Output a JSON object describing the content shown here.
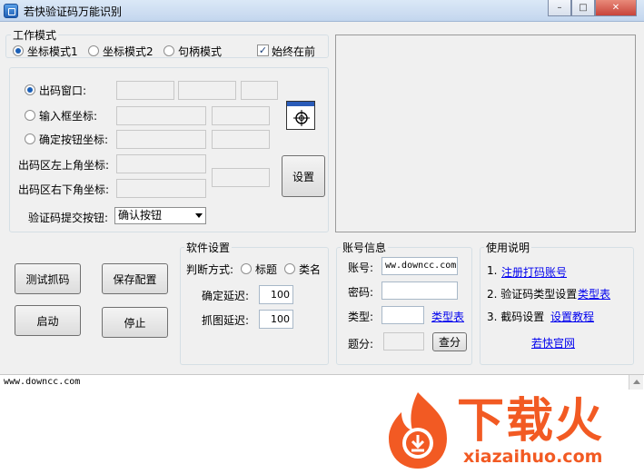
{
  "window": {
    "title": "若快验证码万能识别",
    "minimize": "–",
    "maximize": "□",
    "close": "✕"
  },
  "work_mode": {
    "title": "工作模式",
    "modes": [
      {
        "label": "坐标模式1",
        "checked": true
      },
      {
        "label": "坐标模式2",
        "checked": false
      },
      {
        "label": "句柄模式",
        "checked": false
      }
    ],
    "always_on_top": {
      "label": "始终在前",
      "checked": true
    }
  },
  "coords": {
    "code_window": "出码窗口:",
    "input_box": "输入框坐标:",
    "confirm_button": "确定按钮坐标:",
    "top_left": "出码区左上角坐标:",
    "bottom_right": "出码区右下角坐标:",
    "submit_label": "验证码提交按钮:",
    "submit_value": "确认按钮",
    "set_button": "设置"
  },
  "actions": {
    "test": "测试抓码",
    "save": "保存配置",
    "start": "启动",
    "stop": "停止"
  },
  "software": {
    "title": "软件设置",
    "judge": "判断方式:",
    "opt_title": "标题",
    "opt_class": "类名",
    "confirm_delay_label": "确定延迟:",
    "confirm_delay": "100",
    "capture_delay_label": "抓图延迟:",
    "capture_delay": "100"
  },
  "account": {
    "title": "账号信息",
    "account_label": "账号:",
    "account_value": "ww.downcc.com",
    "password_label": "密码:",
    "type_label": "类型:",
    "type_link": "类型表",
    "score_label": "题分:",
    "query_button": "查分"
  },
  "help": {
    "title": "使用说明",
    "step1": "1.",
    "step1_link": "注册打码账号",
    "step2": "2. 验证码类型设置",
    "step2_link": "类型表",
    "step3": "3. 截码设置",
    "step3_link": "设置教程",
    "site_link": "若快官网"
  },
  "log": {
    "text": "www.downcc.com"
  },
  "watermark": {
    "cn": "下载火",
    "en": "xiazaihuo.com",
    "accent": "#f25a23"
  }
}
